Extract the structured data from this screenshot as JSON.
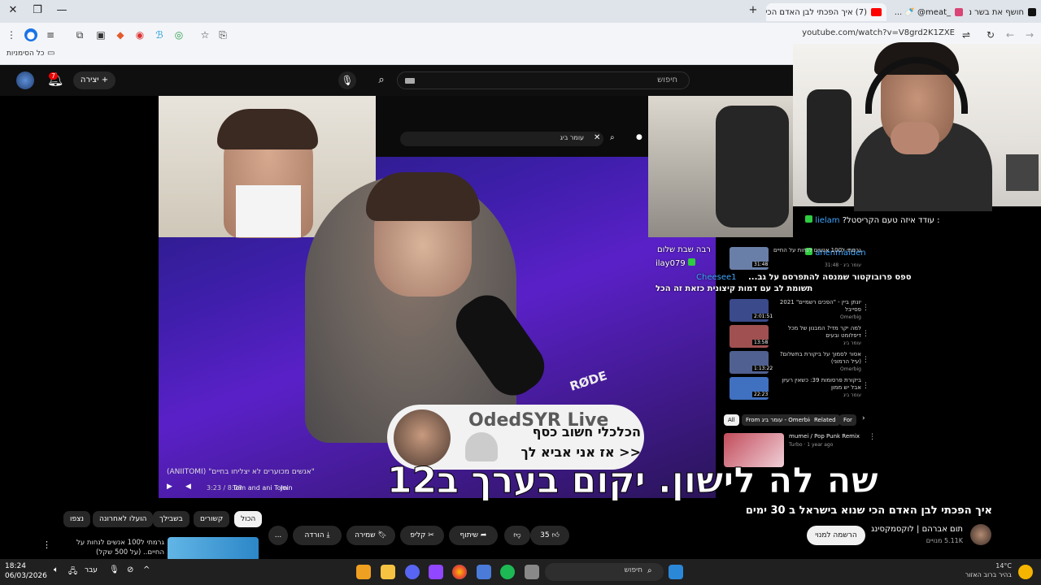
{
  "browser": {
    "tabs": [
      {
        "title": "חושף את בשר נא",
        "icon": "tiktok-icon",
        "color": "#111111"
      },
      {
        "title": "_meat@ 🍼 ...",
        "icon": "instagram-icon",
        "color": "#d94575"
      },
      {
        "title": "(7) איך הפכתי לבן האדם הכי ש...",
        "icon": "youtube-icon",
        "color": "#ff0000"
      }
    ],
    "url": "youtube.com/watch?v=V8grd2K1ZXE",
    "bookmarks_label": "כל הסימניות"
  },
  "youtube": {
    "search_placeholder": "חיפוש",
    "create_label": "יצירה",
    "notifications_count": "7"
  },
  "video": {
    "inner_search": "עומר ביג",
    "live_title": "OdedSYR Live",
    "live_line1": "הכלכלי חשוב כסף",
    "live_line2": "<< אז אני אביא לך",
    "big_caption": "שה לה לישון. יקום בערך ב12",
    "overlay_title": "\"אנשים מכוערים לא יצליחו בחיים\" (ANIITOMI)",
    "overlay_channel": "Tom and ani Tom",
    "overlay_join": "Join",
    "overlay_time": "3:23 / 8:08",
    "brand": "RØDE"
  },
  "chat": [
    {
      "user": "lielam",
      "text": ": עודד איזה טעם הקריסטל?",
      "color": "#3ea6ff"
    },
    {
      "user": "anenmaiden",
      "text": "",
      "color": "#3ea6ff"
    },
    {
      "user": "ilay079",
      "text": "",
      "color": "#ffffff"
    },
    {
      "user": "Cheesee1",
      "text": "",
      "color": "#3ea6ff"
    },
    {
      "user": "רבה שבת שלום",
      "text": "",
      "color": "#ffffff"
    },
    {
      "user": "ספס פרובוקטור שמנסה להתפרסם על גב...",
      "text": "",
      "color": "#ffffff"
    },
    {
      "user": "תשומת לב עם דמות קיצונית כזאת זה הכל",
      "text": "",
      "color": "#ffffff"
    }
  ],
  "sidebar": {
    "videos": [
      {
        "title": "גרמתי ל100 אנשים לנחות על החיים",
        "meta": "עומר ביג · 31:48",
        "duration": "31:48",
        "color": "#6a7fa8"
      },
      {
        "title": "יונתן ביין - \"הפכים רשמיים\" 2021 פסייבל",
        "meta": "Omerbig",
        "duration": "2:01:51",
        "color": "#3a4a8a"
      },
      {
        "title": "למה יקר מדי? המבנון של מכל דיפלומט ובעים",
        "meta": "עומר ביג",
        "duration": "13:58",
        "color": "#a05050"
      },
      {
        "title": "אסור לסמוך על ביקורת בתשלום? (עיל הרמוני)",
        "meta": "Omerbig",
        "duration": "1:13:22",
        "color": "#506090"
      },
      {
        "title": "ביקורת פרסומות 39: כשאין רעיון אבל יש ממון",
        "meta": "עומר ביג",
        "duration": "22:23",
        "color": "#4070c0"
      }
    ],
    "chips": [
      "All",
      "From עומר ביג - Omerbig",
      "Related",
      "For"
    ],
    "music_title": "mumei / Pop Punk Remix",
    "music_meta": "Turbo · 1 year ago"
  },
  "watch": {
    "title": "איך הפכתי לבן האדם הכי שנוא בישראל ב 30 ימים",
    "channel": "תום אברהם | לוקסמקסינג",
    "subscribers": "5.11K מנויים",
    "subscribe_label": "הרשמה למנוי",
    "likes": "35",
    "share_label": "שיתוף",
    "clip_label": "קליפ",
    "save_label": "שמירה",
    "download_label": "הורדה",
    "more_label": "...",
    "filter_chips": [
      "הכול",
      "קשורים",
      "בשבילך",
      "הועלו לאחרונה",
      "נצפו"
    ],
    "recommended": {
      "title": "גרמתי ל100 אנשים לנחות על החיים.. (על 500 שקל)"
    }
  },
  "taskbar": {
    "time": "18:24",
    "date": "06/03/2026",
    "lang": "עבר",
    "search": "חיפוש",
    "weather_temp": "14°C",
    "weather_desc": "בהיר ברוב האזור"
  }
}
